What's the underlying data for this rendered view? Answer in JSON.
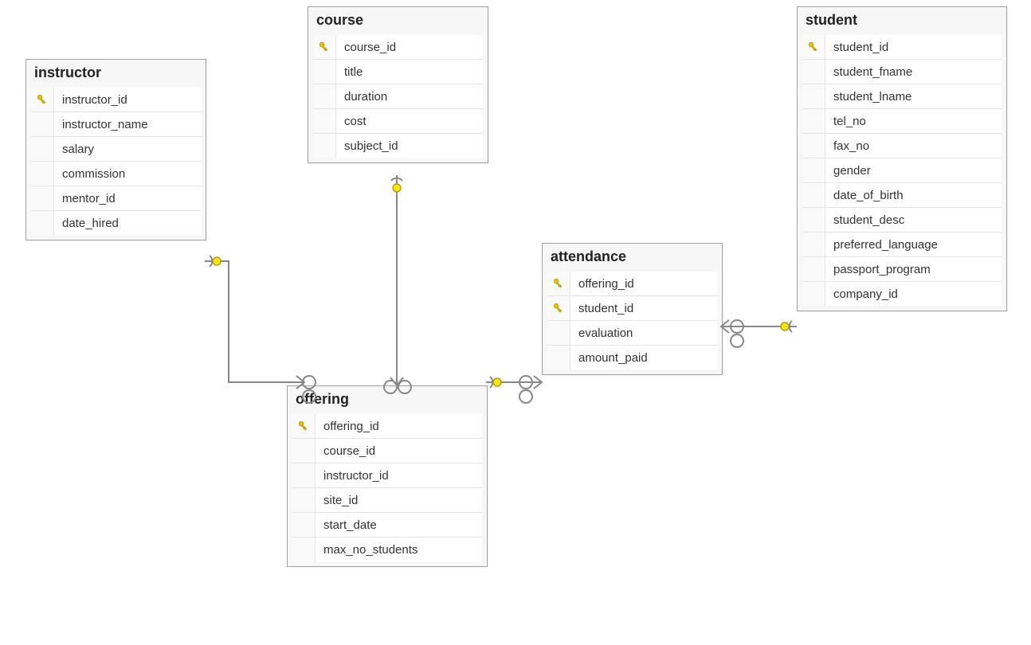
{
  "entities": {
    "instructor": {
      "title": "instructor",
      "columns": [
        {
          "name": "instructor_id",
          "pk": true
        },
        {
          "name": "instructor_name",
          "pk": false
        },
        {
          "name": "salary",
          "pk": false
        },
        {
          "name": "commission",
          "pk": false
        },
        {
          "name": "mentor_id",
          "pk": false
        },
        {
          "name": "date_hired",
          "pk": false
        }
      ]
    },
    "course": {
      "title": "course",
      "columns": [
        {
          "name": "course_id",
          "pk": true
        },
        {
          "name": "title",
          "pk": false
        },
        {
          "name": "duration",
          "pk": false
        },
        {
          "name": "cost",
          "pk": false
        },
        {
          "name": "subject_id",
          "pk": false
        }
      ]
    },
    "offering": {
      "title": "offering",
      "columns": [
        {
          "name": "offering_id",
          "pk": true
        },
        {
          "name": "course_id",
          "pk": false
        },
        {
          "name": "instructor_id",
          "pk": false
        },
        {
          "name": "site_id",
          "pk": false
        },
        {
          "name": "start_date",
          "pk": false
        },
        {
          "name": "max_no_students",
          "pk": false
        }
      ]
    },
    "attendance": {
      "title": "attendance",
      "columns": [
        {
          "name": "offering_id",
          "pk": true
        },
        {
          "name": "student_id",
          "pk": true
        },
        {
          "name": "evaluation",
          "pk": false
        },
        {
          "name": "amount_paid",
          "pk": false
        }
      ]
    },
    "student": {
      "title": "student",
      "columns": [
        {
          "name": "student_id",
          "pk": true
        },
        {
          "name": "student_fname",
          "pk": false
        },
        {
          "name": "student_lname",
          "pk": false
        },
        {
          "name": "tel_no",
          "pk": false
        },
        {
          "name": "fax_no",
          "pk": false
        },
        {
          "name": "gender",
          "pk": false
        },
        {
          "name": "date_of_birth",
          "pk": false
        },
        {
          "name": "student_desc",
          "pk": false
        },
        {
          "name": "preferred_language",
          "pk": false
        },
        {
          "name": "passport_program",
          "pk": false
        },
        {
          "name": "company_id",
          "pk": false
        }
      ]
    }
  },
  "relationships": [
    {
      "from": "instructor",
      "to": "offering",
      "type": "one-to-many"
    },
    {
      "from": "course",
      "to": "offering",
      "type": "one-to-many"
    },
    {
      "from": "offering",
      "to": "attendance",
      "type": "one-to-many"
    },
    {
      "from": "student",
      "to": "attendance",
      "type": "one-to-many"
    }
  ]
}
